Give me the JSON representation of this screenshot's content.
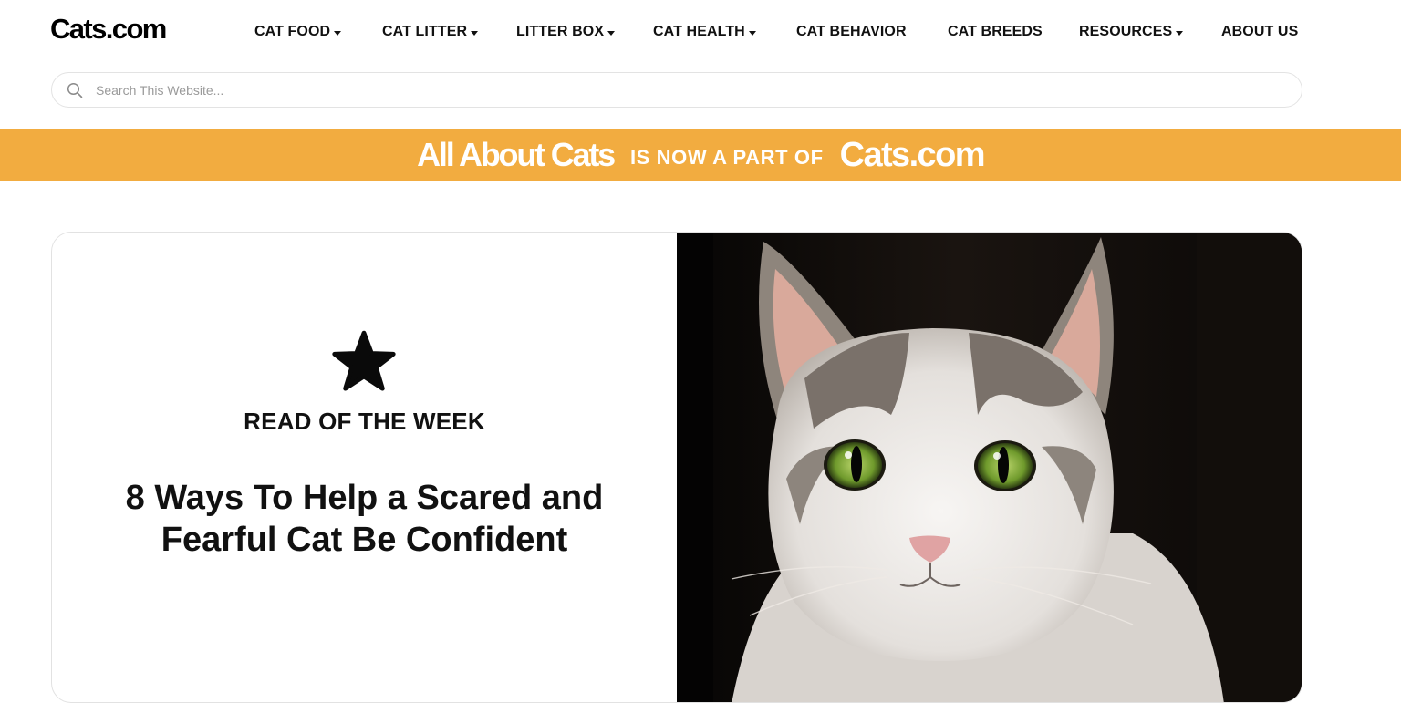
{
  "header": {
    "logo": "Cats.com",
    "nav": [
      {
        "label": "CAT FOOD",
        "has_dropdown": true
      },
      {
        "label": "CAT LITTER",
        "has_dropdown": true
      },
      {
        "label": "LITTER BOX",
        "has_dropdown": true
      },
      {
        "label": "CAT HEALTH",
        "has_dropdown": true
      },
      {
        "label": "CAT BEHAVIOR",
        "has_dropdown": false
      },
      {
        "label": "CAT BREEDS",
        "has_dropdown": false
      },
      {
        "label": "RESOURCES",
        "has_dropdown": true
      },
      {
        "label": "ABOUT US",
        "has_dropdown": false
      }
    ]
  },
  "search": {
    "placeholder": "Search This Website...",
    "value": "",
    "icon": "search-icon"
  },
  "banner": {
    "brand_old": "All About Cats",
    "middle": "IS NOW A PART OF",
    "brand_new": "Cats.com",
    "background": "#f2ac40"
  },
  "feature": {
    "icon": "star-icon",
    "label": "READ OF THE WEEK",
    "title": "8 Ways To Help a Scared and Fearful Cat Be Confident",
    "image": "cat-photo"
  }
}
